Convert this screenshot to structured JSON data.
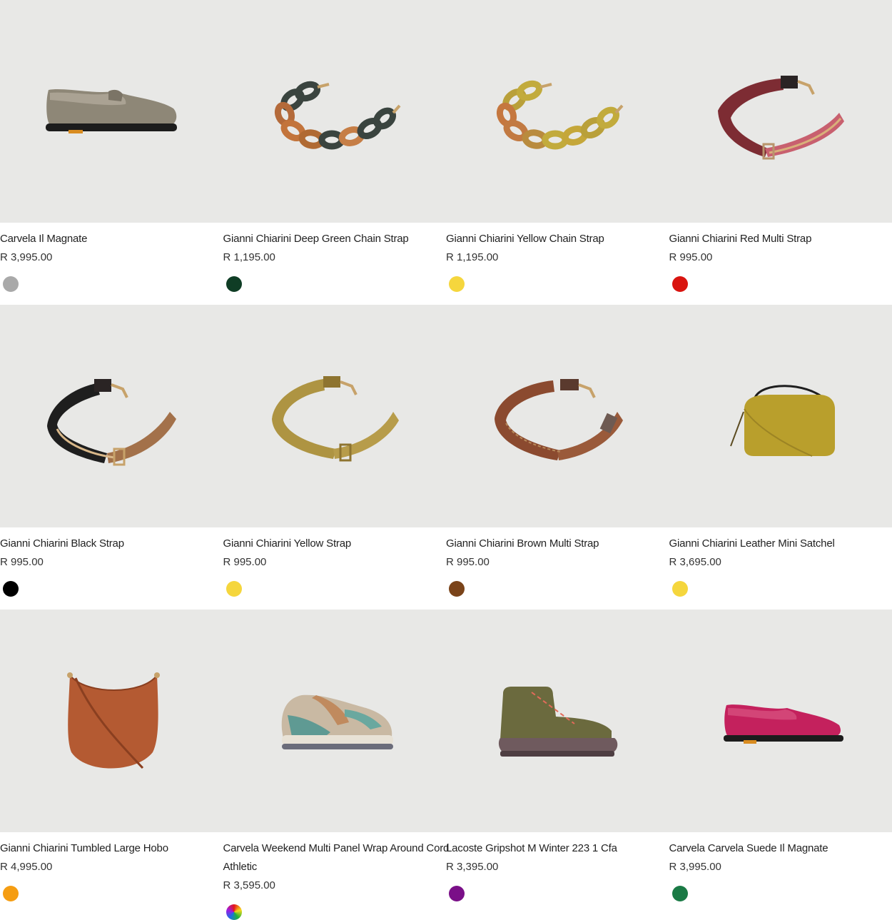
{
  "products": [
    {
      "name": "Carvela Il Magnate",
      "price": "R 3,995.00",
      "swatch": "#a9a9a9",
      "icon": "loafer-shoe-image"
    },
    {
      "name": "Gianni Chiarini Deep Green Chain Strap",
      "price": "R 1,195.00",
      "swatch": "#0f3d25",
      "icon": "chain-strap-image"
    },
    {
      "name": "Gianni Chiarini Yellow Chain Strap",
      "price": "R 1,195.00",
      "swatch": "#f5d63d",
      "icon": "chain-strap-image"
    },
    {
      "name": "Gianni Chiarini Red Multi Strap",
      "price": "R 995.00",
      "swatch": "#d9140f",
      "icon": "bag-strap-image"
    },
    {
      "name": "Gianni Chiarini Black Strap",
      "price": "R 995.00",
      "swatch": "#000000",
      "icon": "bag-strap-image"
    },
    {
      "name": "Gianni Chiarini Yellow Strap",
      "price": "R 995.00",
      "swatch": "#f5d63d",
      "icon": "bag-strap-image"
    },
    {
      "name": "Gianni Chiarini Brown Multi Strap",
      "price": "R 995.00",
      "swatch": "#7a4319",
      "icon": "bag-strap-image"
    },
    {
      "name": "Gianni Chiarini Leather Mini Satchel",
      "price": "R 3,695.00",
      "swatch": "#f5d63d",
      "icon": "mini-satchel-image"
    },
    {
      "name": "Gianni Chiarini Tumbled Large Hobo",
      "price": "R 4,995.00",
      "swatch": "#f59d12",
      "icon": "hobo-bag-image"
    },
    {
      "name": "Carvela Weekend Multi Panel Wrap Around Cord Athletic",
      "price": "R 3,595.00",
      "swatch": "multicolor",
      "icon": "sneaker-image"
    },
    {
      "name": "Lacoste Gripshot M Winter 223 1 Cfa",
      "price": "R 3,395.00",
      "swatch": "#7a0f88",
      "icon": "boot-image"
    },
    {
      "name": "Carvela Carvela Suede Il Magnate",
      "price": "R 3,995.00",
      "swatch": "#1a7a45",
      "icon": "loafer-shoe-image"
    }
  ]
}
